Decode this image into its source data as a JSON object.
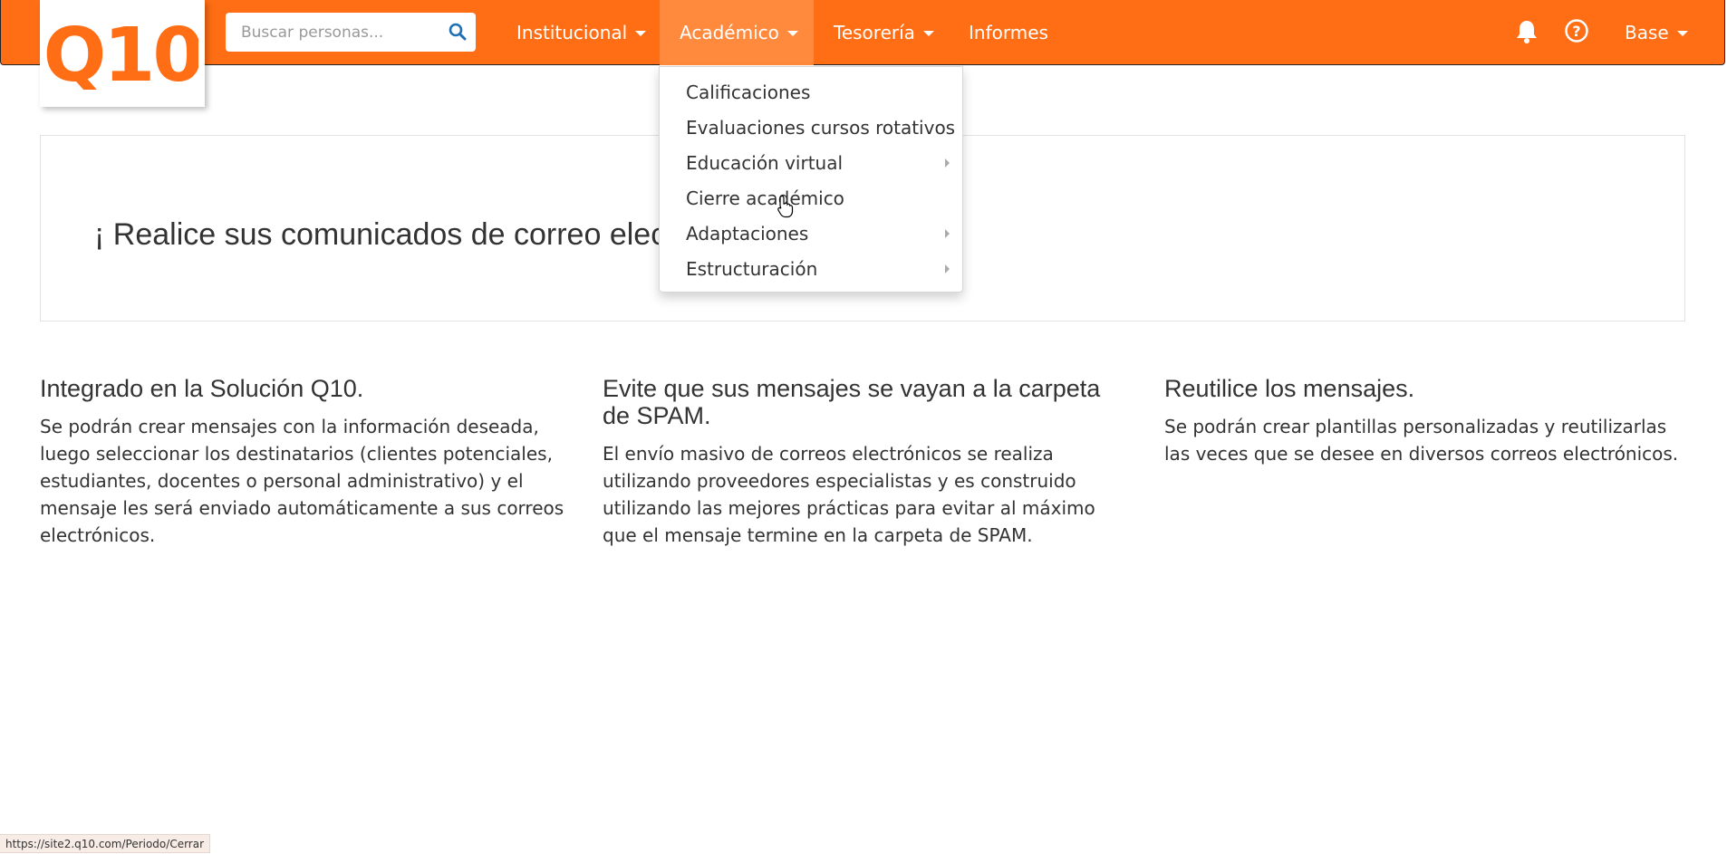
{
  "brand": {
    "logo_text": "Q10",
    "accent": "#ff6e14",
    "accent_active": "#ff8a3d"
  },
  "search": {
    "placeholder": "Buscar personas...",
    "value": "",
    "icon": "search-icon"
  },
  "nav": {
    "items": [
      {
        "label": "Institucional",
        "dropdown": true,
        "active": false
      },
      {
        "label": "Académico",
        "dropdown": true,
        "active": true
      },
      {
        "label": "Tesorería",
        "dropdown": true,
        "active": false
      },
      {
        "label": "Informes",
        "dropdown": false,
        "active": false
      }
    ],
    "icons": [
      "bell-icon",
      "help-icon"
    ],
    "user_menu_label": "Base"
  },
  "academico_menu": {
    "items": [
      {
        "label": "Calificaciones",
        "submenu": false
      },
      {
        "label": "Evaluaciones cursos rotativos",
        "submenu": false
      },
      {
        "label": "Educación virtual",
        "submenu": true
      },
      {
        "label": "Cierre académico",
        "submenu": false,
        "hovered": true
      },
      {
        "label": "Adaptaciones",
        "submenu": true
      },
      {
        "label": "Estructuración",
        "submenu": true
      }
    ]
  },
  "banner": {
    "text": "¡ Realice sus comunicados de correo electrónico"
  },
  "features": [
    {
      "title": "Integrado en la Solución Q10.",
      "body": "Se podrán crear mensajes con la información deseada, luego seleccionar los destinatarios (clientes potenciales, estudiantes, docentes o personal administrativo) y el mensaje les será enviado automáticamente a sus correos electrónicos."
    },
    {
      "title": "Evite que sus mensajes se vayan a la carpeta de SPAM.",
      "body": "El envío masivo de correos electrónicos se realiza utilizando proveedores especialistas y es construido utilizando las mejores prácticas para evitar al máximo que el mensaje termine en la carpeta de SPAM."
    },
    {
      "title": "Reutilice los mensajes.",
      "body": "Se podrán crear plantillas personalizadas y reutilizarlas las veces que se desee en diversos correos electrónicos."
    }
  ],
  "status_bar": {
    "url": "https://site2.q10.com/Periodo/Cerrar"
  }
}
